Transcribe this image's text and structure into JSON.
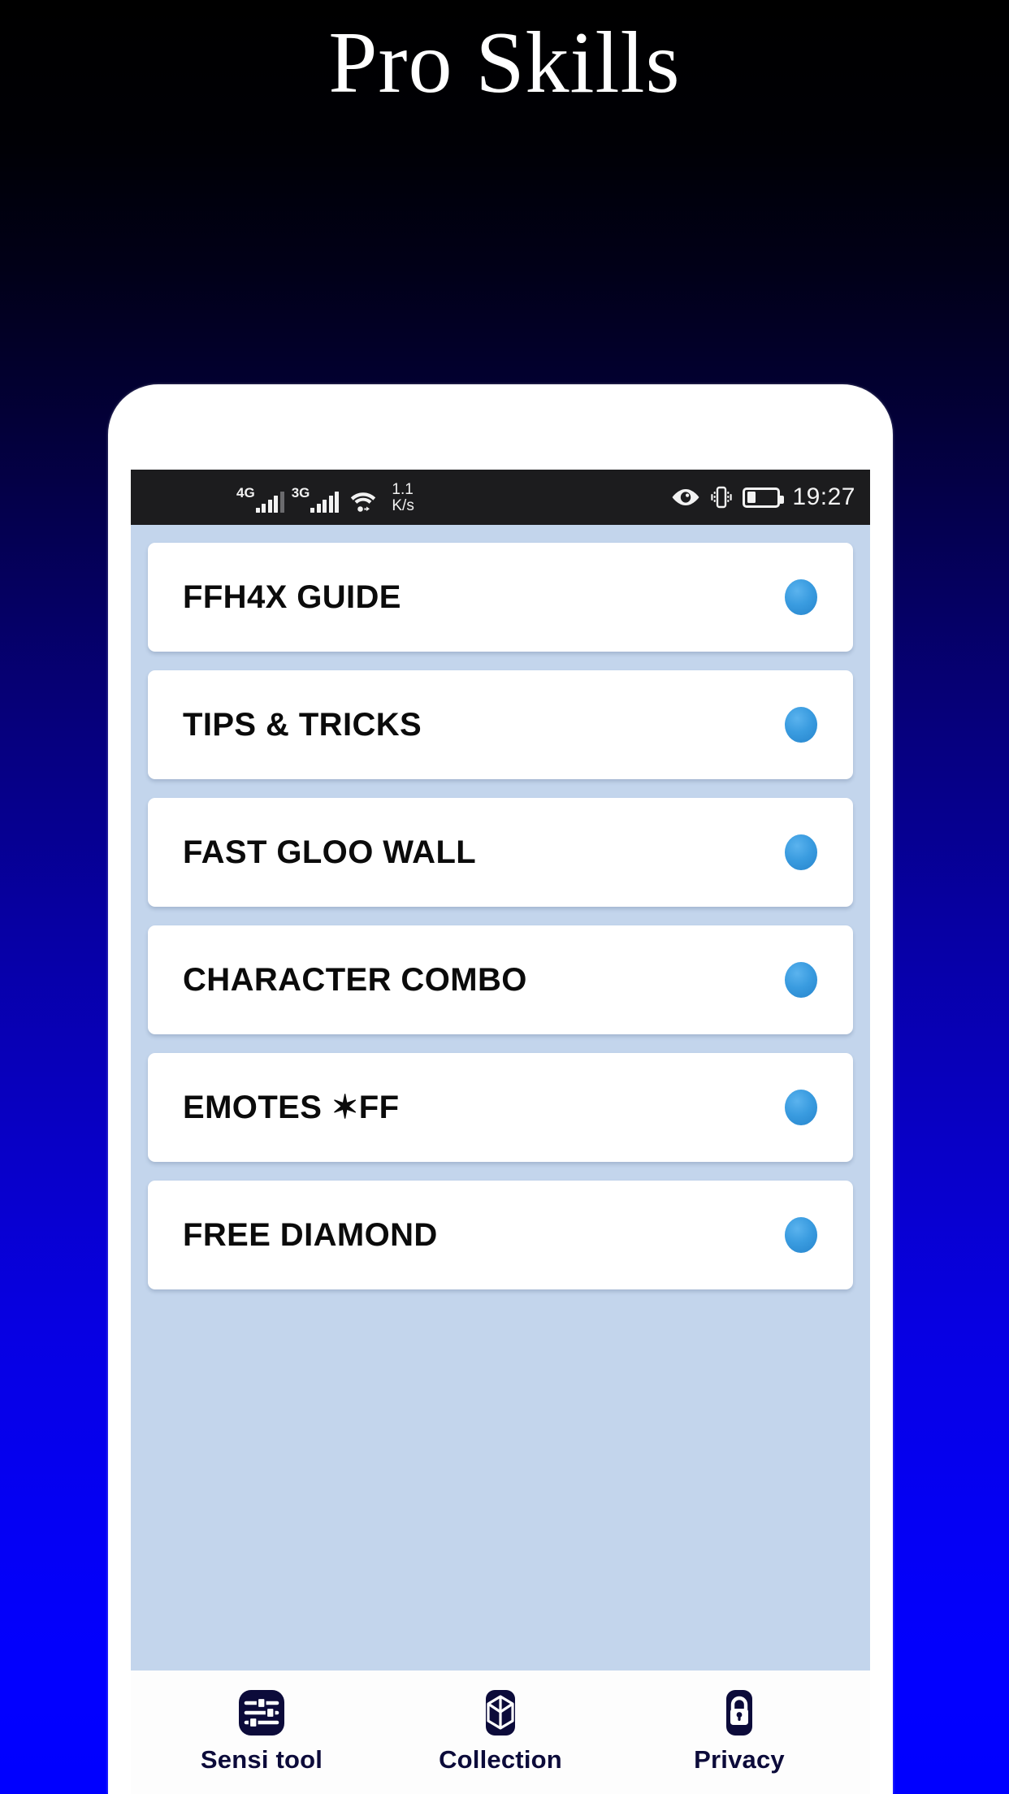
{
  "app": {
    "title": "Pro Skills"
  },
  "status_bar": {
    "network_primary": "4G",
    "network_secondary": "3G",
    "wifi_icon": "wifi-icon",
    "data_speed_value": "1.1",
    "data_speed_unit": "K/s",
    "eye_icon": "eye-comfort-icon",
    "vibrate_icon": "vibrate-icon",
    "battery_icon": "battery-icon",
    "battery_level_percent": 30,
    "time": "19:27"
  },
  "menu": {
    "items": [
      {
        "label": "FFH4X GUIDE",
        "indicator": "blue-dot"
      },
      {
        "label": "TIPS & TRICKS",
        "indicator": "blue-dot"
      },
      {
        "label": "FAST GLOO WALL",
        "indicator": "blue-dot"
      },
      {
        "label": "CHARACTER COMBO",
        "indicator": "blue-dot"
      },
      {
        "label": "EMOTES ✶FF",
        "indicator": "blue-dot"
      },
      {
        "label": "FREE DIAMOND",
        "indicator": "blue-dot"
      }
    ]
  },
  "bottom_nav": {
    "items": [
      {
        "label": "Sensi tool",
        "icon": "sliders-icon"
      },
      {
        "label": "Collection",
        "icon": "cube-icon"
      },
      {
        "label": "Privacy",
        "icon": "lock-icon"
      }
    ]
  },
  "colors": {
    "background_top": "#000000",
    "background_bottom": "#0000ff",
    "screen_background": "#c3d5ec",
    "card_background": "#ffffff",
    "accent_dot": "#3a9ce0",
    "nav_icon": "#0c0b3a",
    "status_bar": "#1c1c1e"
  }
}
